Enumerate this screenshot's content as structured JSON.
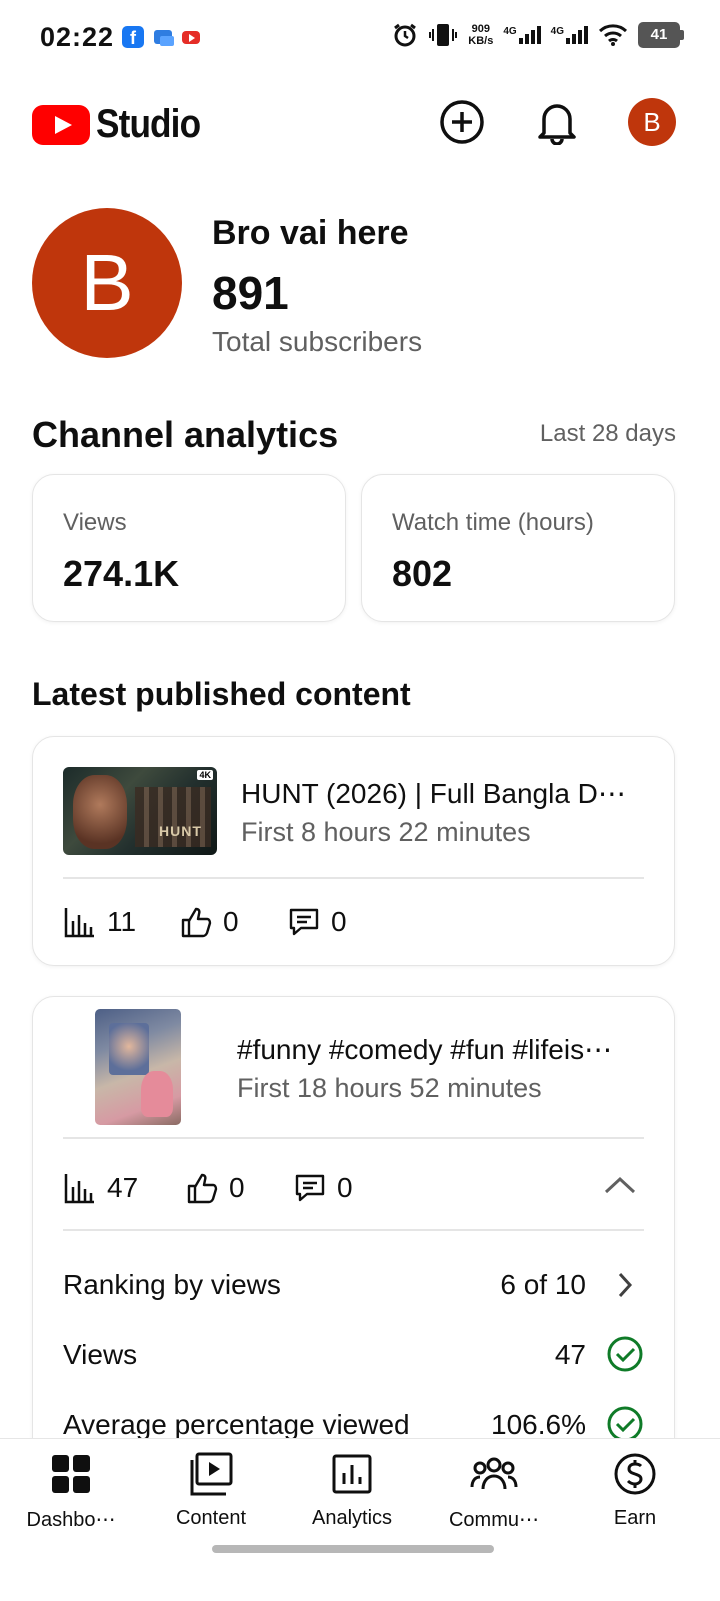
{
  "status_bar": {
    "time": "02:22",
    "speed_value": "909",
    "speed_unit": "KB/s",
    "net1": "4G",
    "net2": "4G",
    "battery": "41"
  },
  "header": {
    "logo_text": "Studio",
    "avatar_letter": "B"
  },
  "channel": {
    "avatar_letter": "B",
    "name": "Bro vai here",
    "subscribers": "891",
    "subscribers_label": "Total subscribers"
  },
  "analytics": {
    "title": "Channel analytics",
    "period": "Last 28 days",
    "cards": [
      {
        "label": "Views",
        "value": "274.1K"
      },
      {
        "label": "Watch time (hours)",
        "value": "802"
      }
    ]
  },
  "latest": {
    "title": "Latest published content",
    "items": [
      {
        "title": "HUNT (2026) | Full Bangla D⋯",
        "subtitle": "First 8 hours 22 minutes",
        "thumb_text": "HUNT",
        "thumb_badge": "4K",
        "views": "11",
        "likes": "0",
        "comments": "0"
      },
      {
        "title": "#funny #comedy #fun #lifeis⋯",
        "subtitle": "First 18 hours 52 minutes",
        "views": "47",
        "likes": "0",
        "comments": "0",
        "details": [
          {
            "label": "Ranking by views",
            "value": "6 of 10"
          },
          {
            "label": "Views",
            "value": "47"
          },
          {
            "label": "Average percentage viewed",
            "value": "106.6%"
          }
        ]
      }
    ]
  },
  "nav": {
    "items": [
      {
        "label": "Dashbo⋯"
      },
      {
        "label": "Content"
      },
      {
        "label": "Analytics"
      },
      {
        "label": "Commu⋯"
      },
      {
        "label": "Earn"
      }
    ]
  },
  "colors": {
    "brand_red": "#ff0000",
    "avatar": "#bf360c",
    "check_green": "#0f7b28",
    "muted_text": "#606060"
  }
}
